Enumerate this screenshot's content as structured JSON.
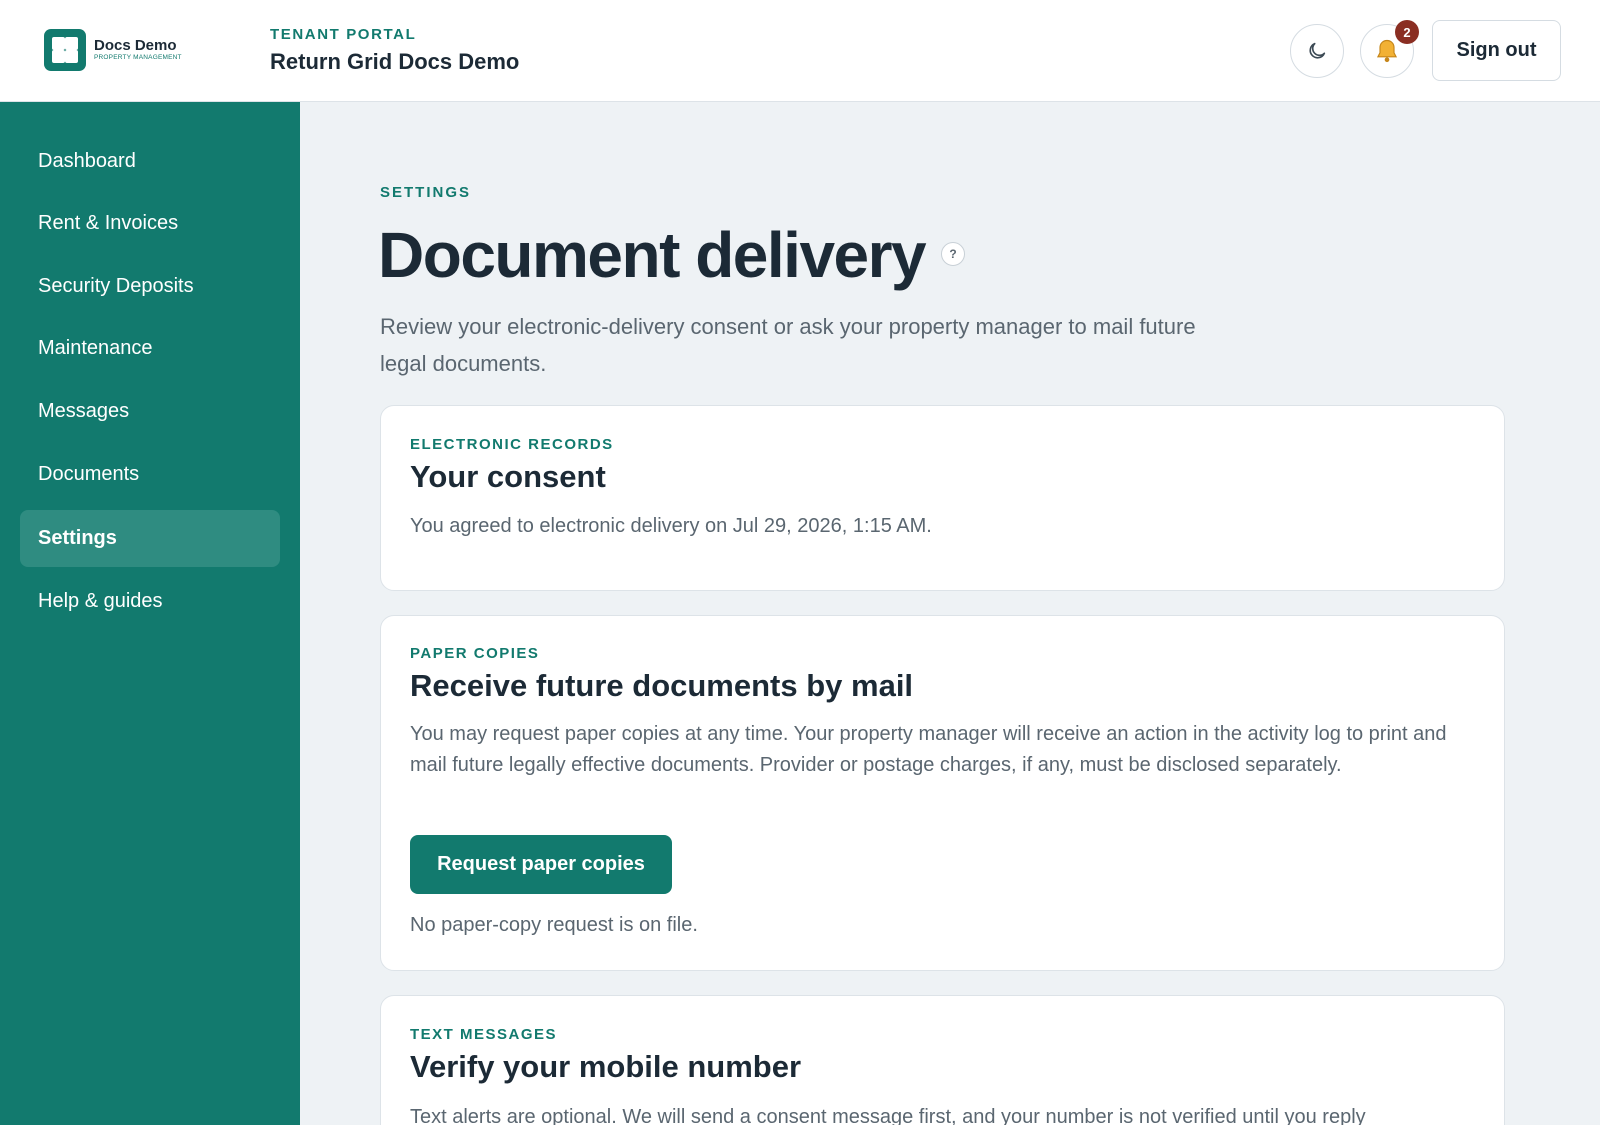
{
  "brand": {
    "name": "Docs Demo",
    "subtitle": "PROPERTY MANAGEMENT",
    "color": "#127a6e"
  },
  "header": {
    "eyebrow": "TENANT PORTAL",
    "title": "Return Grid Docs Demo",
    "theme_icon": "moon-icon",
    "notifications_icon": "bell-icon",
    "notification_count": "2",
    "sign_out_label": "Sign out"
  },
  "sidebar": {
    "items": [
      {
        "label": "Dashboard"
      },
      {
        "label": "Rent & Invoices"
      },
      {
        "label": "Security Deposits"
      },
      {
        "label": "Maintenance"
      },
      {
        "label": "Messages"
      },
      {
        "label": "Documents"
      },
      {
        "label": "Settings",
        "active": true
      },
      {
        "label": "Help & guides"
      }
    ]
  },
  "page": {
    "eyebrow": "SETTINGS",
    "title": "Document delivery",
    "help_icon_label": "?",
    "intro": "Review your electronic-delivery consent or ask your property manager to mail future legal documents."
  },
  "cards": {
    "consent": {
      "eyebrow": "ELECTRONIC RECORDS",
      "title": "Your consent",
      "body": "You agreed to electronic delivery on Jul 29, 2026, 1:15 AM."
    },
    "paper": {
      "eyebrow": "PAPER COPIES",
      "title": "Receive future documents by mail",
      "body": "You may request paper copies at any time. Your property manager will receive an action in the activity log to print and mail future legally effective documents. Provider or postage charges, if any, must be disclosed separately.",
      "button_label": "Request paper copies",
      "status": "No paper-copy request is on file."
    },
    "sms": {
      "eyebrow": "TEXT MESSAGES",
      "title": "Verify your mobile number",
      "body": "Text alerts are optional. We will send a consent message first, and your number is not verified until you reply"
    }
  }
}
